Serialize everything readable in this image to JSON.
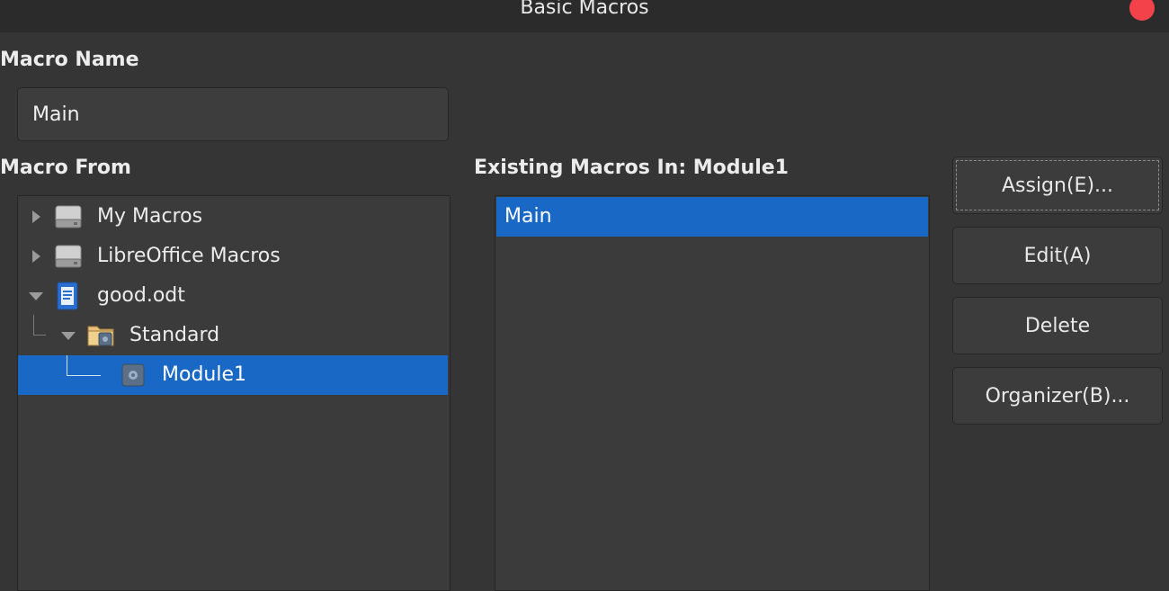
{
  "window": {
    "title": "Basic Macros"
  },
  "macro_name": {
    "label": "Macro Name",
    "value": "Main"
  },
  "macro_from": {
    "label": "Macro From",
    "tree": [
      {
        "label": "My Macros",
        "icon": "drive-icon",
        "expanded": false,
        "selected": false
      },
      {
        "label": "LibreOffice Macros",
        "icon": "drive-icon",
        "expanded": false,
        "selected": false
      },
      {
        "label": "good.odt",
        "icon": "document-icon",
        "expanded": true,
        "selected": false
      },
      {
        "label": "Standard",
        "icon": "library-folder-icon",
        "expanded": true,
        "selected": false
      },
      {
        "label": "Module1",
        "icon": "module-icon",
        "selected": true
      }
    ]
  },
  "existing_macros": {
    "label": "Existing Macros In: Module1",
    "items": [
      {
        "label": "Main",
        "selected": true
      }
    ]
  },
  "buttons": {
    "assign": "Assign(E)...",
    "edit": "Edit(A)",
    "delete": "Delete",
    "organizer": "Organizer(B)..."
  },
  "colors": {
    "background": "#353535",
    "selection": "#1a68c6",
    "close": "#f4424a"
  }
}
